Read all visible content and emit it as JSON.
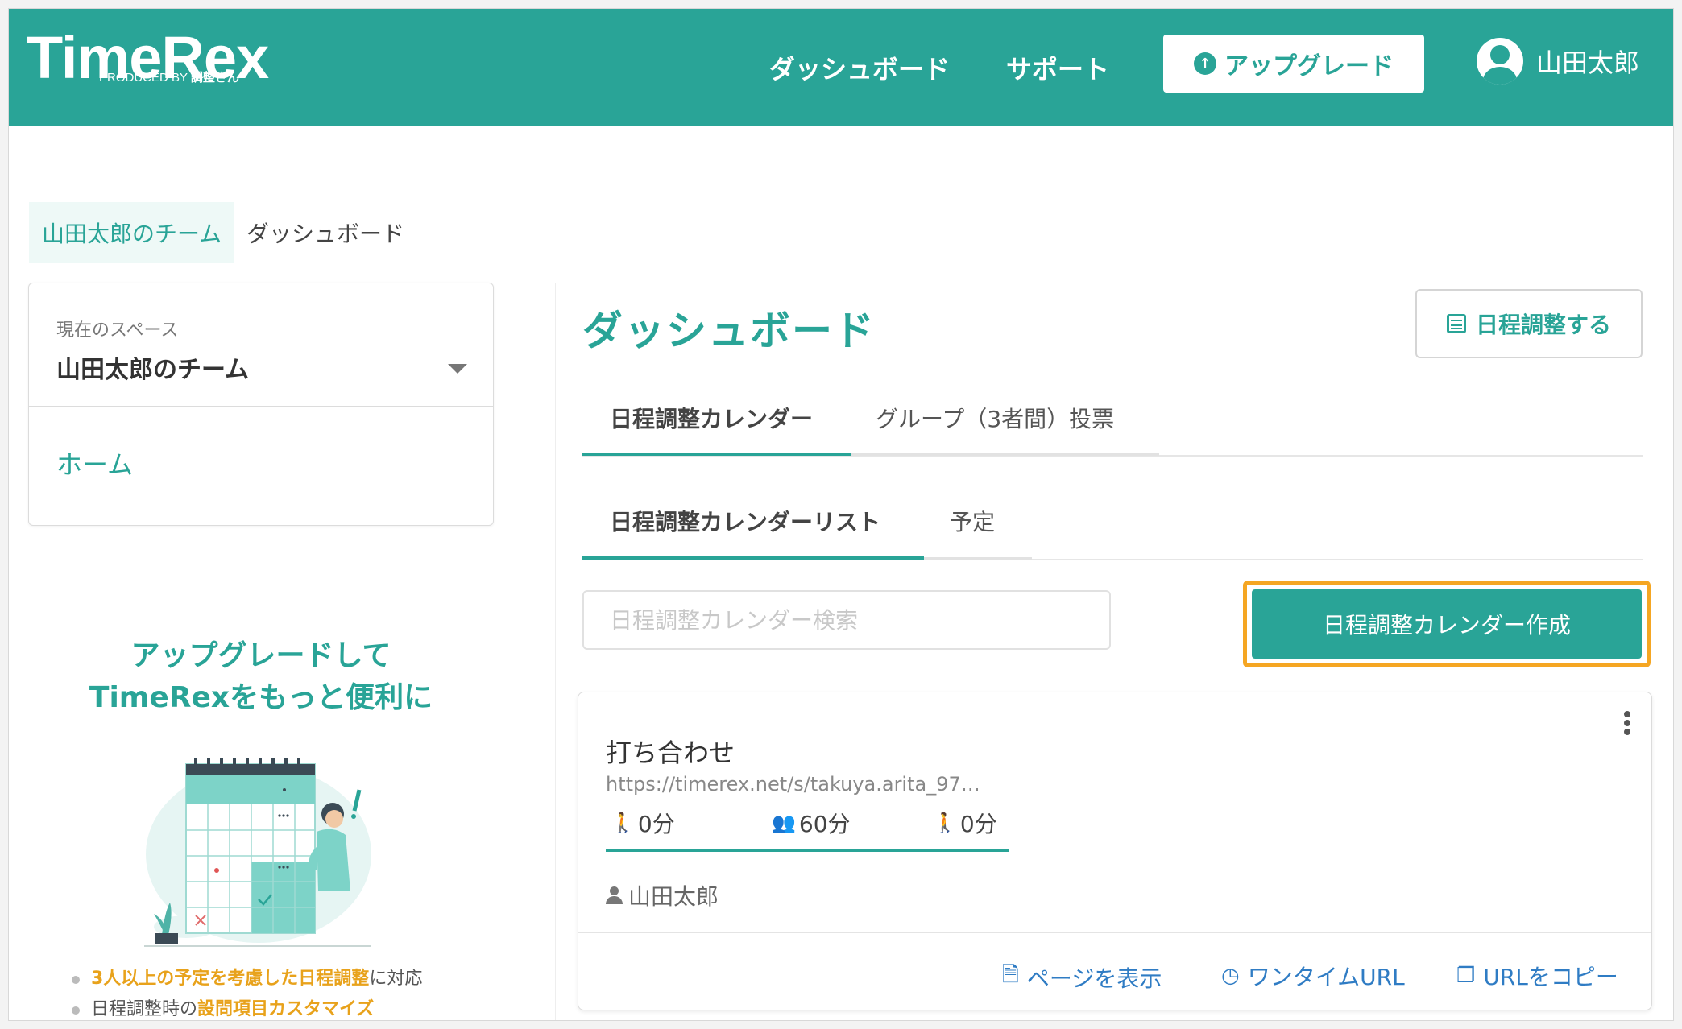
{
  "header": {
    "logo": "TimeRex",
    "logo_sub_prefix": "PRODUCED BY ",
    "logo_sub_brand": "調整さん",
    "nav": [
      "ダッシュボード",
      "サポート"
    ],
    "upgrade_label": "アップグレード",
    "user_name": "山田太郎"
  },
  "breadcrumb": {
    "team": "山田太郎のチーム",
    "current": "ダッシュボード"
  },
  "sidebar": {
    "space_label": "現在のスペース",
    "space_name": "山田太郎のチーム",
    "home_label": "ホーム"
  },
  "promo": {
    "title_line1": "アップグレードして",
    "title_line2": "TimeRexをもっと便利に",
    "item1_highlight": "3人以上の予定を考慮した日程調整",
    "item1_suffix": "に対応",
    "item2_prefix": "日程調整時の",
    "item2_highlight": "設問項目カスタマイズ"
  },
  "main": {
    "title": "ダッシュボード",
    "schedule_button": "日程調整する",
    "tabs": [
      "日程調整カレンダー",
      "グループ（3者間）投票"
    ],
    "subtabs": [
      "日程調整カレンダーリスト",
      "予定"
    ],
    "search_placeholder": "日程調整カレンダー検索",
    "create_button": "日程調整カレンダー作成"
  },
  "calendar_card": {
    "title": "打ち合わせ",
    "url": "https://timerex.net/s/takuya.arita_97…",
    "before_buffer": "0分",
    "duration": "60分",
    "after_buffer": "0分",
    "owner": "山田太郎",
    "actions": [
      "ページを表示",
      "ワンタイムURL",
      "URLをコピー"
    ]
  },
  "colors": {
    "brand": "#29a497",
    "highlight_border": "#f5a623",
    "link": "#2f7cc4",
    "promo_highlight": "#e8a21b"
  }
}
